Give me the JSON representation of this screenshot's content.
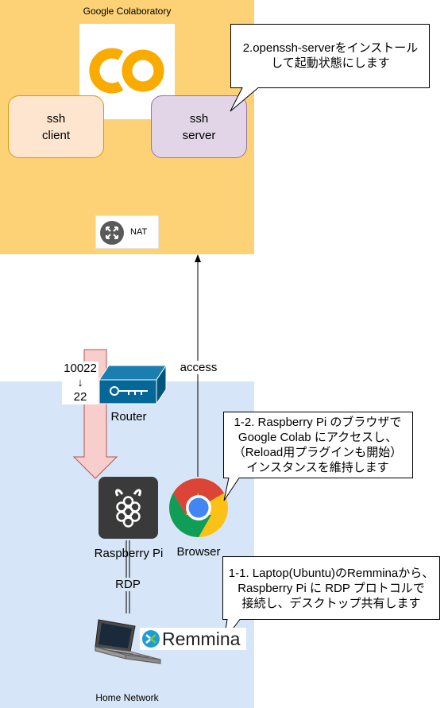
{
  "colab": {
    "zone_label": "Google Colaboratory",
    "ssh_client": [
      "ssh",
      "client"
    ],
    "ssh_server": [
      "ssh",
      "server"
    ],
    "nat_label": "NAT",
    "callout_openssh": [
      "2.openssh-serverをインストール",
      "して起動状態にします"
    ]
  },
  "home": {
    "zone_label": "Home Network",
    "router_label": "Router",
    "port_forward": [
      "10022",
      "↓",
      "22"
    ],
    "access_label": "access",
    "raspberry_label": "Raspberry Pi",
    "browser_label": "Browser",
    "rdp_label": "RDP",
    "remmina_label": "Remmina",
    "callout_browser": [
      "1-2. Raspberry Pi のブラウザで",
      "Google Colab にアクセスし、",
      "（Reload用プラグインも開始）",
      "インスタンスを維持します"
    ],
    "callout_remmina": [
      "1-1. Laptop(Ubuntu)のRemminaから、",
      "Raspberry Pi に RDP プロトコルで",
      "接続し、デスクトップ共有します"
    ]
  },
  "colors": {
    "colab_zone": "#fdd276",
    "home_zone": "#d6e5f7",
    "ssh_client_fill": "#fde5cf",
    "ssh_server_fill": "#e1d5e7",
    "router": "#036897",
    "colab_logo": "#f9ab00"
  }
}
